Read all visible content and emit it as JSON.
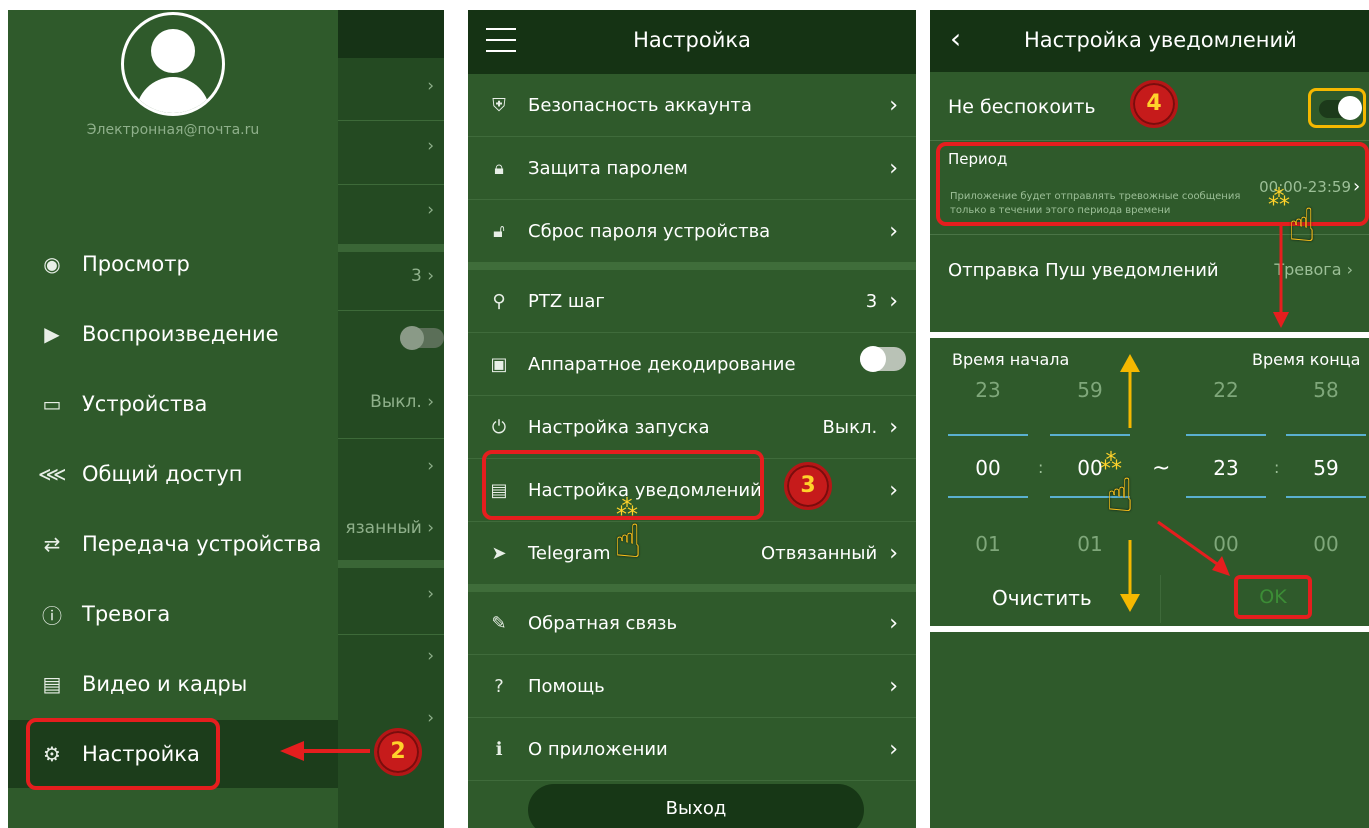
{
  "drawer": {
    "email": "Электронная@почта.ru",
    "items": [
      {
        "icon": "eye-icon",
        "glyph": "◉",
        "label": "Просмотр"
      },
      {
        "icon": "play-icon",
        "glyph": "▶",
        "label": "Воспроизведение"
      },
      {
        "icon": "device-icon",
        "glyph": "▭",
        "label": "Устройства"
      },
      {
        "icon": "share-icon",
        "glyph": "⋘",
        "label": "Общий доступ"
      },
      {
        "icon": "transfer-icon",
        "glyph": "⇄",
        "label": "Передача устройства"
      },
      {
        "icon": "alarm-icon",
        "glyph": "ⓘ",
        "label": "Тревога"
      },
      {
        "icon": "folder-icon",
        "glyph": "▤",
        "label": "Видео и кадры"
      },
      {
        "icon": "gear-icon",
        "glyph": "⚙",
        "label": "Настройка"
      }
    ],
    "bg_values": {
      "ptz": "3",
      "startup": "Выкл.",
      "telegram": "язанный"
    },
    "callout": "2"
  },
  "settings": {
    "title": "Настройка",
    "rows": [
      {
        "icon": "shield-icon",
        "glyph": "⛨",
        "label": "Безопасность аккаунта",
        "value": ""
      },
      {
        "icon": "lock-icon",
        "glyph": "🔒︎",
        "label": "Защита паролем",
        "value": ""
      },
      {
        "icon": "lock-reset-icon",
        "glyph": "🔓︎",
        "label": "Сброс пароля устройства",
        "value": ""
      },
      {
        "icon": "ptz-icon",
        "glyph": "⚲",
        "label": "PTZ шаг",
        "value": "3"
      },
      {
        "icon": "decode-icon",
        "glyph": "▣",
        "label": "Аппаратное декодирование",
        "value": ""
      },
      {
        "icon": "power-icon",
        "glyph": "⏻",
        "label": "Настройка запуска",
        "value": "Выкл."
      },
      {
        "icon": "message-icon",
        "glyph": "▤",
        "label": "Настройка уведомлений",
        "value": ""
      },
      {
        "icon": "telegram-icon",
        "glyph": "➤",
        "label": "Telegram",
        "value": "Отвязанный"
      },
      {
        "icon": "feedback-icon",
        "glyph": "✎",
        "label": "Обратная связь",
        "value": ""
      },
      {
        "icon": "help-icon",
        "glyph": "?",
        "label": "Помощь",
        "value": ""
      },
      {
        "icon": "info-icon",
        "glyph": "ℹ",
        "label": "О приложении",
        "value": ""
      }
    ],
    "logout": "Выход",
    "callout": "3"
  },
  "notifications": {
    "title": "Настройка уведомлений",
    "dnd_label": "Не беспокоить",
    "dnd_on": true,
    "period_label": "Период",
    "period_desc": "Приложение будет отправлять тревожные сообщения только в течении этого периода времени",
    "period_value": "00:00-23:59",
    "push_label": "Отправка Пуш уведомлений",
    "push_value": "Тревога",
    "callout": "4"
  },
  "time_picker": {
    "start_label": "Время начала",
    "end_label": "Время конца",
    "columns": [
      {
        "prev": "23",
        "current": "00",
        "next": "01"
      },
      {
        "prev": "59",
        "current": "00",
        "next": "01"
      },
      {
        "prev": "22",
        "current": "23",
        "next": "00"
      },
      {
        "prev": "58",
        "current": "59",
        "next": "00"
      }
    ],
    "colon": ":",
    "tilde": "~",
    "clear": "Очистить",
    "ok": "OK"
  },
  "colors": {
    "panel_bg": "#2f5a2b",
    "header_bg": "#153314",
    "callout_red": "#e51e1e",
    "arrow_yellow": "#f5b800"
  }
}
